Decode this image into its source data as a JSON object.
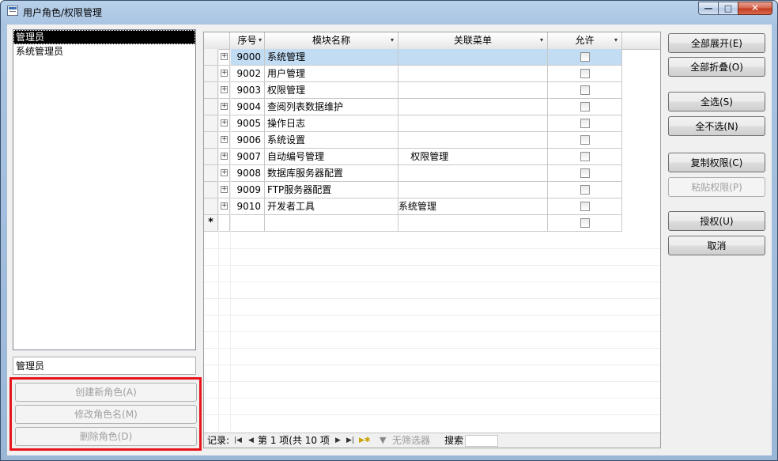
{
  "window": {
    "title": "用户角色/权限管理",
    "buttons": {
      "minimize": "—",
      "maximize": "□",
      "close": "✕"
    }
  },
  "roles": {
    "items": [
      "管理员",
      "系统管理员"
    ],
    "selected_index": 0,
    "name_field_value": "管理员"
  },
  "role_actions": {
    "create": "创建新角色(A)",
    "rename": "修改角色名(M)",
    "delete": "删除角色(D)"
  },
  "grid": {
    "columns": {
      "num": "序号",
      "name": "模块名称",
      "menu": "关联菜单",
      "allow": "允许"
    },
    "new_row_marker": "*",
    "rows": [
      {
        "num": "9000",
        "name": "系统管理",
        "menu": "",
        "allow": false
      },
      {
        "num": "9002",
        "name": "用户管理",
        "menu": "",
        "allow": false
      },
      {
        "num": "9003",
        "name": "权限管理",
        "menu": "",
        "allow": false
      },
      {
        "num": "9004",
        "name": "查阅列表数据维护",
        "menu": "",
        "allow": false
      },
      {
        "num": "9005",
        "name": "操作日志",
        "menu": "",
        "allow": false
      },
      {
        "num": "9006",
        "name": "系统设置",
        "menu": "",
        "allow": false
      },
      {
        "num": "9007",
        "name": "自动编号管理",
        "menu": "    权限管理",
        "allow": false
      },
      {
        "num": "9008",
        "name": "数据库服务器配置",
        "menu": "",
        "allow": false
      },
      {
        "num": "9009",
        "name": "FTP服务器配置",
        "menu": "",
        "allow": false
      },
      {
        "num": "9010",
        "name": "开发者工具",
        "menu": "系统管理",
        "allow": false
      }
    ]
  },
  "navigation": {
    "record_label": "记录:",
    "position_text": "第 1 项(共 10 项",
    "filter_label": "无筛选器",
    "search_label": "搜索"
  },
  "actions": {
    "expand_all": "全部展开(E)",
    "collapse_all": "全部折叠(O)",
    "select_all": "全选(S)",
    "select_none": "全不选(N)",
    "copy_perm": "复制权限(C)",
    "paste_perm": "粘贴权限(P)",
    "grant": "授权(U)",
    "cancel": "取消"
  }
}
